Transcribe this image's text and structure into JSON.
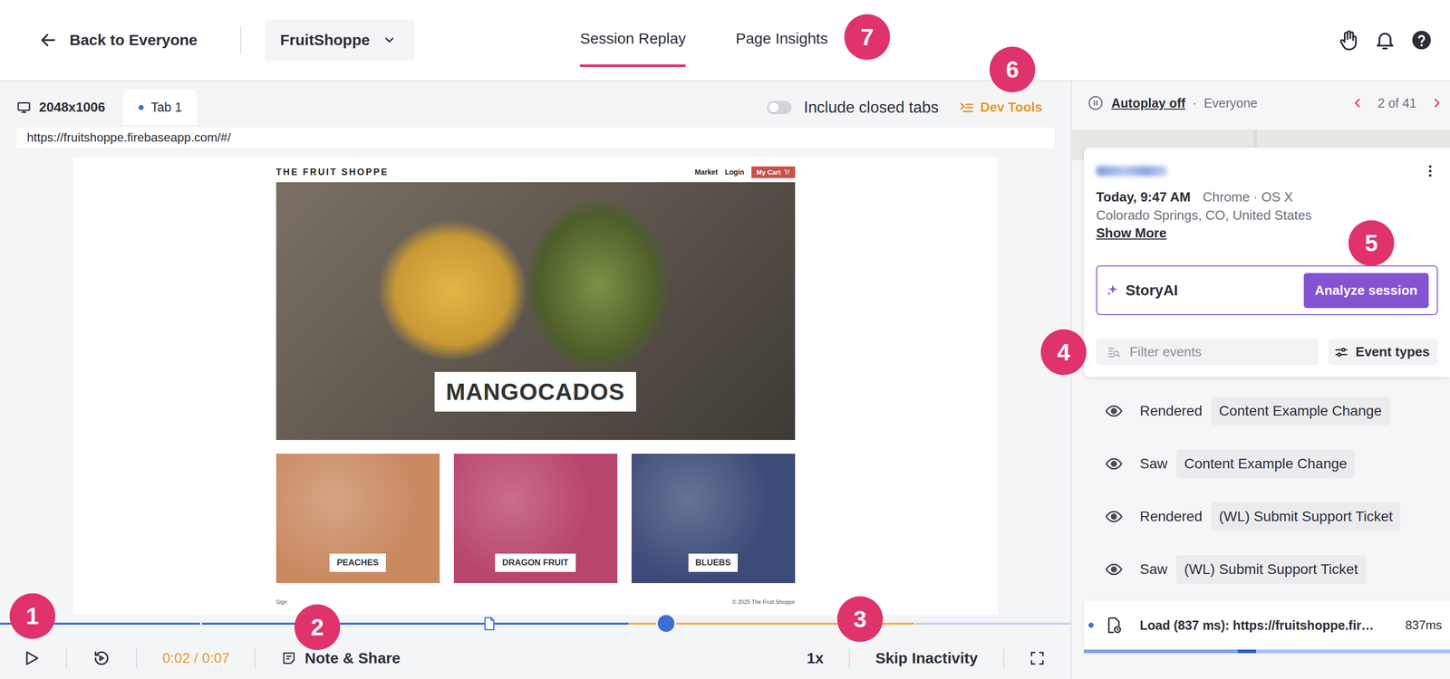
{
  "header": {
    "back_label": "Back to Everyone",
    "app_selector": "FruitShoppe",
    "tabs": [
      {
        "label": "Session Replay",
        "selected": true
      },
      {
        "label": "Page Insights",
        "selected": false
      }
    ]
  },
  "player": {
    "resolution": "2048x1006",
    "tabs": [
      {
        "label": "Tab 1",
        "selected": true
      }
    ],
    "include_closed_tabs": {
      "label": "Include closed tabs",
      "on": false
    },
    "dev_tools": "Dev Tools",
    "url": "https://fruitshoppe.firebaseapp.com/#/",
    "site": {
      "brand": "THE FRUIT SHOPPE",
      "nav": [
        "Market",
        "Login"
      ],
      "cart": "My Cart",
      "hero": "MANGOCADOS",
      "products": [
        {
          "label": "PEACHES",
          "color": "#c98a62"
        },
        {
          "label": "DRAGON FRUIT",
          "color": "#b8456b"
        },
        {
          "label": "BLUEBS",
          "color": "#3d4b78"
        }
      ],
      "footer_left": "Sign",
      "footer_right": "© 2025 The Fruit Shoppe"
    },
    "timeline": {
      "position": 0.622,
      "segments": [
        {
          "kind": "played",
          "level": 0.587,
          "color": "#3b6fd6"
        },
        {
          "kind": "inactive",
          "level": 0.27,
          "color": "#f1b24a"
        },
        {
          "kind": "unplayed",
          "level": 0.143,
          "color": "#c5d2ec"
        }
      ],
      "markers": [
        {
          "kind": "tick",
          "level": 0.188
        },
        {
          "kind": "tick",
          "level": 0.315
        },
        {
          "kind": "page",
          "level": 0.457
        },
        {
          "kind": "tick",
          "level": 0.855
        }
      ]
    },
    "controls": {
      "playing": false,
      "time": "0:02 / 0:07",
      "note": "Note & Share",
      "speed": "1x",
      "skip_inactivity": "Skip Inactivity"
    }
  },
  "session": {
    "autoplay": "Autoplay off",
    "separator": "·",
    "audience": "Everyone",
    "pager": "2 of 41",
    "user_name_blurred": true,
    "time": "Today, 9:47 AM",
    "browser": "Chrome · OS X",
    "location": "Colorado Springs, CO, United States",
    "show_more": "Show More",
    "story_ai": {
      "label": "StoryAI",
      "button": "Analyze session"
    },
    "filter": {
      "placeholder": "Filter events",
      "event_types": "Event types"
    },
    "events": [
      {
        "kind": "view",
        "verb": "Rendered",
        "tag": "Content Example Change",
        "selected": false
      },
      {
        "kind": "view",
        "verb": "Saw",
        "tag": "Content Example Change",
        "selected": false
      },
      {
        "kind": "view",
        "verb": "Rendered",
        "tag": "(WL) Submit Support Ticket",
        "selected": false
      },
      {
        "kind": "view",
        "verb": "Saw",
        "tag": "(WL) Submit Support Ticket",
        "selected": false
      },
      {
        "kind": "load",
        "text": "Load (837 ms): https://fruitshoppe.fir…",
        "duration": "837ms",
        "selected": true,
        "level": 0.42
      }
    ]
  },
  "badges": [
    "1",
    "2",
    "3",
    "4",
    "5",
    "6",
    "7"
  ]
}
